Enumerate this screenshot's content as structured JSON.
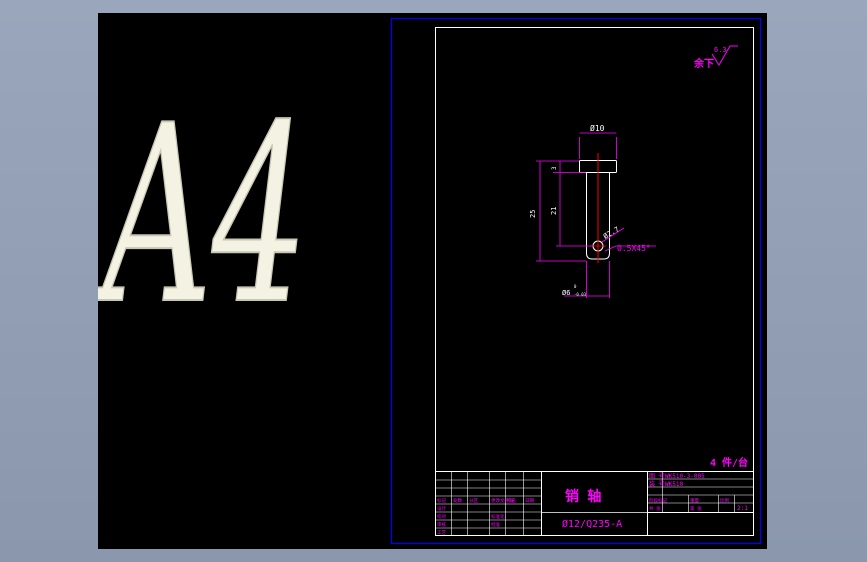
{
  "sheet": {
    "size_label": "A4"
  },
  "roughness": {
    "label": "余下",
    "value": "6.3"
  },
  "dimensions": {
    "head_diameter": "Ø10",
    "head_height": "3",
    "total_length": "25",
    "shank_length": "21",
    "hole_diameter": "Ø2.7",
    "chamfer": "0.5X45°",
    "shank_diameter": "Ø6",
    "tolerance_upper": "0",
    "tolerance_lower": "-0.03"
  },
  "quantity_note": "4 件/台",
  "title_block": {
    "part_name": "销   轴",
    "material": "Ø12/Q235-A",
    "drawing_no_label": "图 号",
    "drawing_no": "WK510-3-005",
    "assembly_label": "装 号",
    "assembly": "WK510",
    "scale_value": "2:1",
    "left_labels": [
      "标记",
      "处数",
      "分区",
      "更改文件号",
      "签名",
      "日期"
    ],
    "role_labels": [
      "设计",
      "校对",
      "审核",
      "工艺",
      "标准化",
      "批准"
    ],
    "right_labels": [
      "阶段标记",
      "重量",
      "比例",
      "共 张",
      "第 张"
    ]
  },
  "colors": {
    "border": "#0000ff",
    "frame": "#ffffff",
    "dimension": "#ff00ff",
    "centerline": "#ff0000",
    "large_text": "#f4f2e2"
  }
}
